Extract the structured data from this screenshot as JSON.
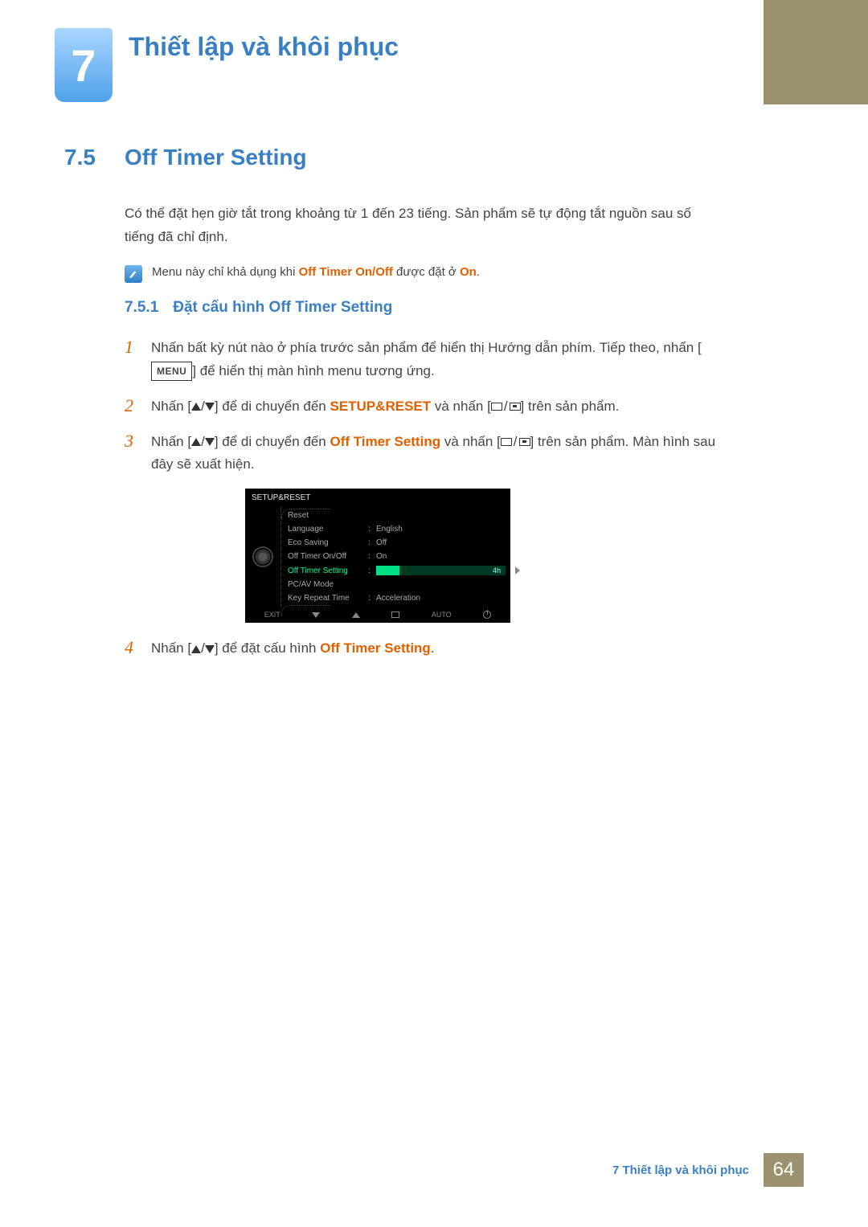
{
  "chapter": {
    "number": "7",
    "title": "Thiết lập và khôi phục"
  },
  "section": {
    "number": "7.5",
    "title": "Off Timer Setting",
    "intro": "Có thể đặt hẹn giờ tắt trong khoảng từ 1 đến 23 tiếng. Sản phẩm sẽ tự động tắt nguồn sau số tiếng đã chỉ định."
  },
  "note": {
    "prefix": "Menu này chỉ khả dụng khi ",
    "em1": "Off Timer On/Off",
    "mid": " được đặt ở ",
    "em2": "On",
    "suffix": "."
  },
  "subsection": {
    "number": "7.5.1",
    "title": "Đặt cấu hình Off Timer Setting"
  },
  "steps": {
    "s1a": "Nhấn bất kỳ nút nào ở phía trước sản phẩm để hiển thị Hướng dẫn phím. Tiếp theo, nhấn [",
    "s1b": "MENU",
    "s1c": "] để hiển thị màn hình menu tương ứng.",
    "s2a": "Nhấn [",
    "s2b": "] để di chuyển đến ",
    "s2c": "SETUP&RESET",
    "s2d": " và nhấn [",
    "s2e": "] trên sản phẩm.",
    "s3a": "Nhấn [",
    "s3b": "] để di chuyển đến ",
    "s3c": "Off Timer Setting",
    "s3d": " và nhấn [",
    "s3e": "] trên sản phẩm. Màn hình sau đây sẽ xuất hiện.",
    "s4a": "Nhấn [",
    "s4b": "] để đặt cấu hình ",
    "s4c": "Off Timer Setting",
    "s4d": "."
  },
  "osd": {
    "title": "SETUP&RESET",
    "rows": {
      "reset": "Reset",
      "language": "Language",
      "language_val": "English",
      "eco": "Eco Saving",
      "eco_val": "Off",
      "timer_onoff": "Off Timer On/Off",
      "timer_onoff_val": "On",
      "timer_setting": "Off Timer Setting",
      "timer_setting_val": "4h",
      "pcav": "PC/AV Mode",
      "keyrepeat": "Key Repeat Time",
      "keyrepeat_val": "Acceleration"
    },
    "footer": {
      "exit": "EXIT",
      "auto": "AUTO"
    }
  },
  "footer": {
    "text": "7 Thiết lập và khôi phục",
    "page": "64"
  }
}
